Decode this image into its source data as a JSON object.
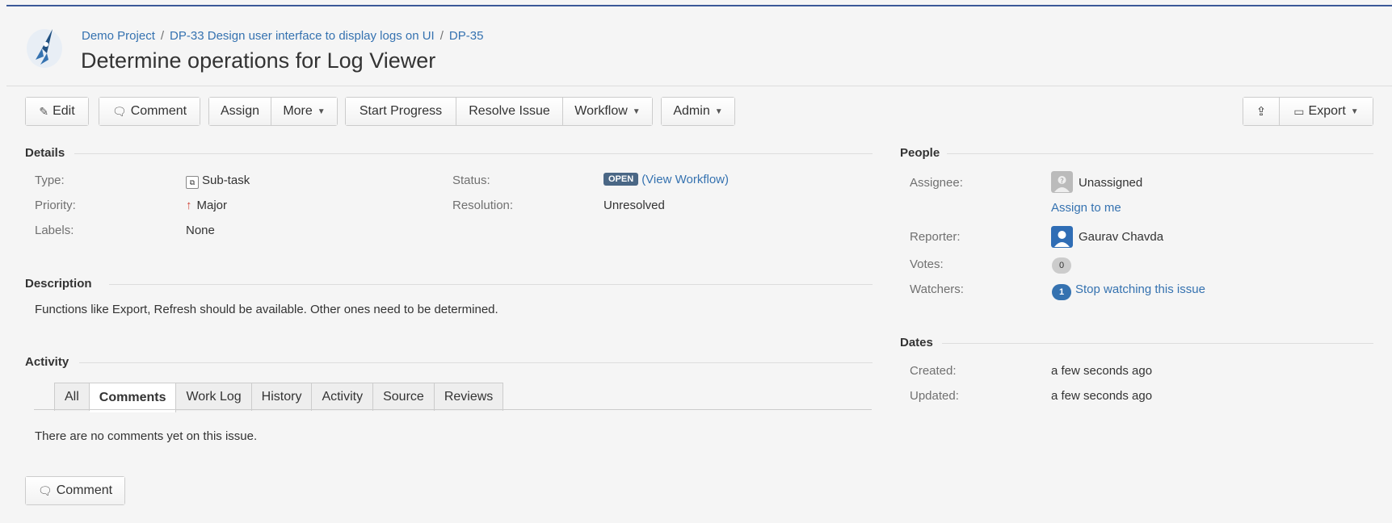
{
  "breadcrumb": {
    "project": "Demo Project",
    "parent": "DP-33 Design user interface to display logs on UI",
    "issue_key": "DP-35"
  },
  "title": "Determine operations for Log Viewer",
  "toolbar": {
    "edit": "Edit",
    "comment": "Comment",
    "assign": "Assign",
    "more": "More",
    "start_progress": "Start Progress",
    "resolve_issue": "Resolve Issue",
    "workflow": "Workflow",
    "admin": "Admin",
    "export": "Export"
  },
  "details": {
    "heading": "Details",
    "type_label": "Type:",
    "type_value": "Sub-task",
    "priority_label": "Priority:",
    "priority_value": "Major",
    "labels_label": "Labels:",
    "labels_value": "None",
    "status_label": "Status:",
    "status_value": "OPEN",
    "view_workflow": "(View Workflow)",
    "resolution_label": "Resolution:",
    "resolution_value": "Unresolved"
  },
  "description": {
    "heading": "Description",
    "text": "Functions like Export, Refresh should be available. Other ones need to be determined."
  },
  "activity": {
    "heading": "Activity",
    "tabs": [
      "All",
      "Comments",
      "Work Log",
      "History",
      "Activity",
      "Source",
      "Reviews"
    ],
    "active_tab": "Comments",
    "empty_text": "There are no comments yet on this issue.",
    "comment_button": "Comment"
  },
  "people": {
    "heading": "People",
    "assignee_label": "Assignee:",
    "assignee_value": "Unassigned",
    "assign_to_me": "Assign to me",
    "reporter_label": "Reporter:",
    "reporter_value": "Gaurav Chavda",
    "votes_label": "Votes:",
    "votes_value": "0",
    "watchers_label": "Watchers:",
    "watchers_count": "1",
    "watchers_link": "Stop watching this issue"
  },
  "dates": {
    "heading": "Dates",
    "created_label": "Created:",
    "created_value": "a few seconds ago",
    "updated_label": "Updated:",
    "updated_value": "a few seconds ago"
  },
  "colors": {
    "link": "#3572b0",
    "status_lozenge": "#4a6785",
    "priority_arrow": "#d04437"
  }
}
